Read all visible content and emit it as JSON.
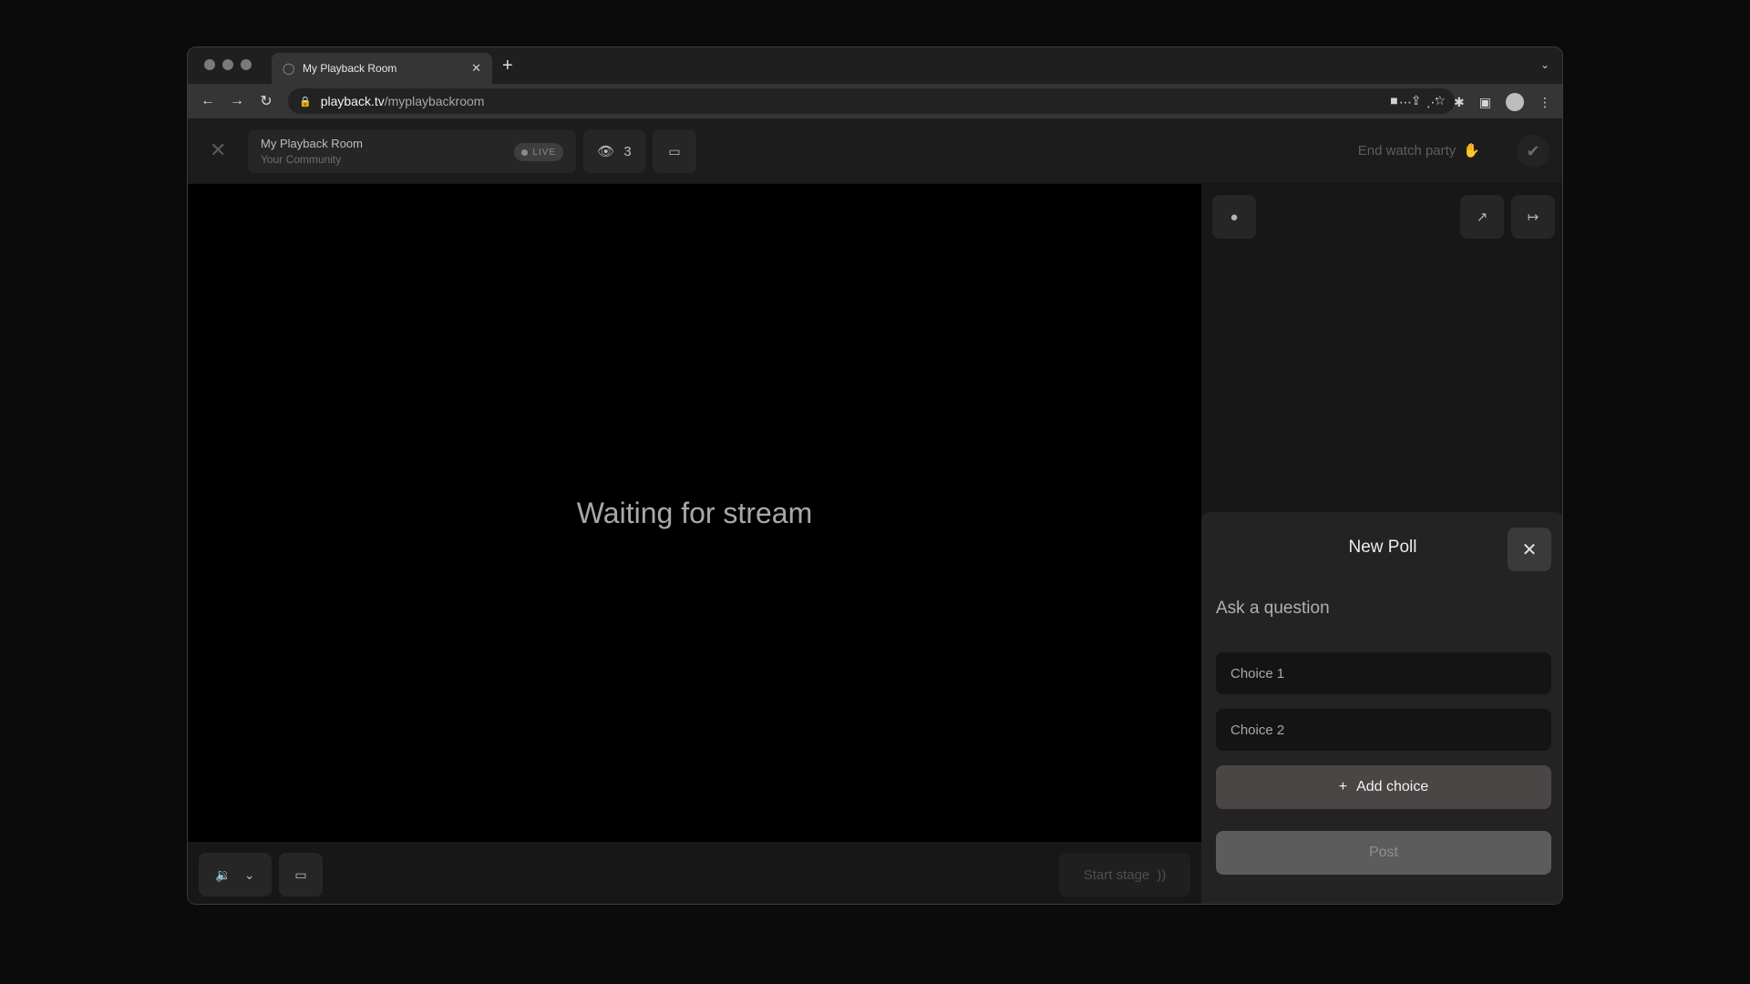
{
  "browser": {
    "tab_title": "My Playback Room",
    "tab_close": "✕",
    "new_tab": "+",
    "url_host": "playback.tv",
    "url_path": "/myplaybackroom"
  },
  "header": {
    "room_title": "My Playback Room",
    "room_subtitle": "Your Community",
    "live_label": "LIVE",
    "viewer_count": "3",
    "end_party_label": "End watch party"
  },
  "video": {
    "status_text": "Waiting for stream"
  },
  "controls": {
    "start_stage_label": "Start stage"
  },
  "poll": {
    "title": "New Poll",
    "question_placeholder": "Ask a question",
    "choice1_placeholder": "Choice 1",
    "choice2_placeholder": "Choice 2",
    "add_choice_label": "Add choice",
    "post_label": "Post"
  }
}
